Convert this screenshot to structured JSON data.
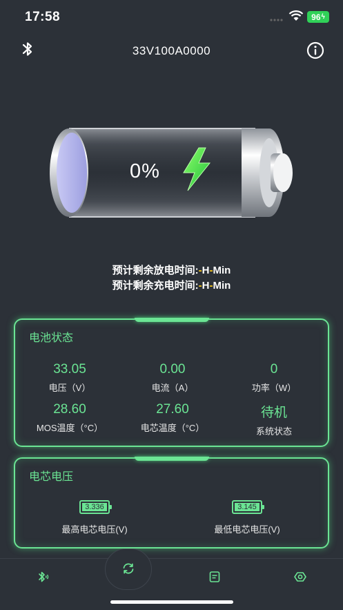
{
  "status_bar": {
    "time": "17:58",
    "battery_level": "96"
  },
  "header": {
    "title": "33V100A0000",
    "left_icon": "bluetooth-icon",
    "right_icon": "info-icon"
  },
  "battery": {
    "percent_text": "0%",
    "level": 0,
    "charge_icon": "lightning-icon"
  },
  "remaining": {
    "discharge_label": "预计剩余放电时间:",
    "charge_label": "预计剩余充电时间:",
    "dash": "-",
    "hour": "H",
    "min": "Min"
  },
  "battery_status": {
    "title": "电池状态",
    "items": [
      {
        "value": "33.05",
        "label": "电压（V）"
      },
      {
        "value": "0.00",
        "label": "电流（A）"
      },
      {
        "value": "0",
        "label": "功率（W）"
      },
      {
        "value": "28.60",
        "label": "MOS温度（°C）"
      },
      {
        "value": "27.60",
        "label": "电芯温度（°C）"
      },
      {
        "value": "待机",
        "label": "系统状态"
      }
    ]
  },
  "cell_voltage": {
    "title": "电芯电压",
    "max_value": "3.336",
    "max_label": "最高电芯电压(V)",
    "min_value": "3.145",
    "min_label": "最低电芯电压(V)"
  },
  "tabbar": {
    "icons": [
      "bluetooth-icon",
      "refresh-icon",
      "document-icon",
      "settings-icon"
    ]
  },
  "colors": {
    "accent": "#6be594",
    "background": "#2c3138",
    "highlight": "#f5c518"
  }
}
